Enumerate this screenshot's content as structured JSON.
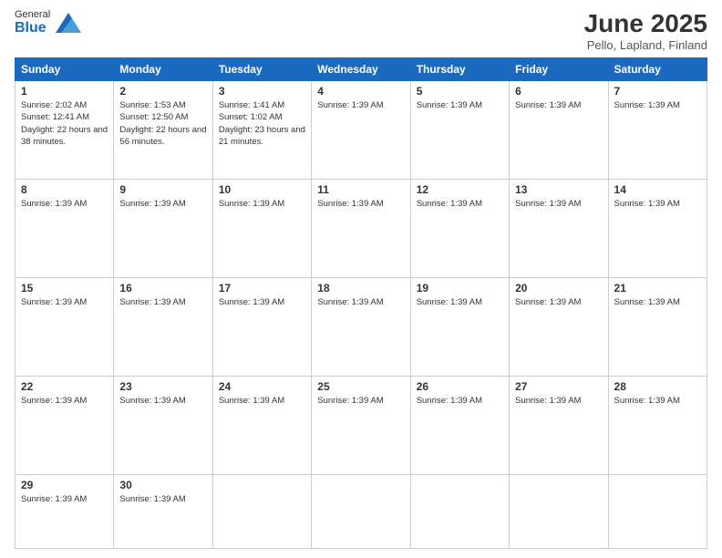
{
  "logo": {
    "general": "General",
    "blue": "Blue"
  },
  "header": {
    "month_year": "June 2025",
    "location": "Pello, Lapland, Finland"
  },
  "days_of_week": [
    "Sunday",
    "Monday",
    "Tuesday",
    "Wednesday",
    "Thursday",
    "Friday",
    "Saturday"
  ],
  "weeks": [
    [
      {
        "day": "1",
        "info": "Sunrise: 2:02 AM\nSunset: 12:41 AM\nDaylight: 22 hours\nand 38 minutes."
      },
      {
        "day": "2",
        "info": "Sunrise: 1:53 AM\nSunset: 12:50 AM\nDaylight: 22 hours\nand 56 minutes."
      },
      {
        "day": "3",
        "info": "Sunrise: 1:41 AM\nSunset: 1:02 AM\nDaylight: 23 hours\nand 21 minutes."
      },
      {
        "day": "4",
        "info": "Sunrise: 1:39 AM"
      },
      {
        "day": "5",
        "info": "Sunrise: 1:39 AM"
      },
      {
        "day": "6",
        "info": "Sunrise: 1:39 AM"
      },
      {
        "day": "7",
        "info": "Sunrise: 1:39 AM"
      }
    ],
    [
      {
        "day": "8",
        "info": "Sunrise: 1:39 AM"
      },
      {
        "day": "9",
        "info": "Sunrise: 1:39 AM"
      },
      {
        "day": "10",
        "info": "Sunrise: 1:39 AM"
      },
      {
        "day": "11",
        "info": "Sunrise: 1:39 AM"
      },
      {
        "day": "12",
        "info": "Sunrise: 1:39 AM"
      },
      {
        "day": "13",
        "info": "Sunrise: 1:39 AM"
      },
      {
        "day": "14",
        "info": "Sunrise: 1:39 AM"
      }
    ],
    [
      {
        "day": "15",
        "info": "Sunrise: 1:39 AM"
      },
      {
        "day": "16",
        "info": "Sunrise: 1:39 AM"
      },
      {
        "day": "17",
        "info": "Sunrise: 1:39 AM"
      },
      {
        "day": "18",
        "info": "Sunrise: 1:39 AM"
      },
      {
        "day": "19",
        "info": "Sunrise: 1:39 AM"
      },
      {
        "day": "20",
        "info": "Sunrise: 1:39 AM"
      },
      {
        "day": "21",
        "info": "Sunrise: 1:39 AM"
      }
    ],
    [
      {
        "day": "22",
        "info": "Sunrise: 1:39 AM"
      },
      {
        "day": "23",
        "info": "Sunrise: 1:39 AM"
      },
      {
        "day": "24",
        "info": "Sunrise: 1:39 AM"
      },
      {
        "day": "25",
        "info": "Sunrise: 1:39 AM"
      },
      {
        "day": "26",
        "info": "Sunrise: 1:39 AM"
      },
      {
        "day": "27",
        "info": "Sunrise: 1:39 AM"
      },
      {
        "day": "28",
        "info": "Sunrise: 1:39 AM"
      }
    ],
    [
      {
        "day": "29",
        "info": "Sunrise: 1:39 AM"
      },
      {
        "day": "30",
        "info": "Sunrise: 1:39 AM"
      },
      null,
      null,
      null,
      null,
      null
    ]
  ]
}
